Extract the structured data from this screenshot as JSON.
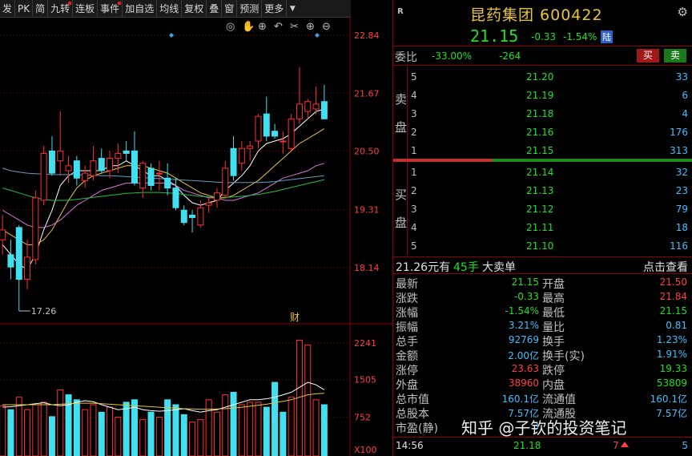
{
  "toolbar": {
    "items": [
      {
        "label": "发",
        "dot": false
      },
      {
        "label": "PK",
        "dot": false
      },
      {
        "label": "简",
        "dot": false
      },
      {
        "label": "九转",
        "dot": true
      },
      {
        "label": "连板",
        "dot": false
      },
      {
        "label": "事件",
        "dot": true
      },
      {
        "label": "加自选",
        "dot": false
      },
      {
        "label": "均线",
        "dot": false
      },
      {
        "label": "复权",
        "dot": false
      },
      {
        "label": "叠",
        "dot": false
      },
      {
        "label": "窗",
        "dot": false
      },
      {
        "label": "预测",
        "dot": false
      },
      {
        "label": "更多",
        "dot": false
      }
    ],
    "dropdown_icon": "dropdown-arrow-icon"
  },
  "chart_tools": [
    "eye-icon",
    "hand-icon",
    "zoom-in-icon",
    "undo-icon",
    "scissors-icon",
    "plus-circle-icon",
    "minus-circle-icon"
  ],
  "chart_data": [
    {
      "type": "candlestick",
      "y_ticks": [
        "22.84",
        "21.67",
        "20.50",
        "19.31",
        "18.14"
      ],
      "ylim": [
        17.0,
        23.2
      ],
      "low_marker": "17.26",
      "event_marker": "财",
      "candles": [
        {
          "o": 18.7,
          "h": 19.2,
          "l": 18.4,
          "c": 18.9
        },
        {
          "o": 18.4,
          "h": 18.7,
          "l": 17.9,
          "c": 18.15
        },
        {
          "o": 18.95,
          "h": 19.0,
          "l": 17.26,
          "c": 17.9
        },
        {
          "o": 17.9,
          "h": 18.7,
          "l": 17.7,
          "c": 18.35
        },
        {
          "o": 18.3,
          "h": 19.7,
          "l": 18.2,
          "c": 19.55
        },
        {
          "o": 19.5,
          "h": 20.6,
          "l": 19.4,
          "c": 20.45
        },
        {
          "o": 20.5,
          "h": 20.8,
          "l": 20.0,
          "c": 20.05
        },
        {
          "o": 20.3,
          "h": 21.3,
          "l": 20.0,
          "c": 20.5
        },
        {
          "o": 20.1,
          "h": 20.4,
          "l": 19.85,
          "c": 20.2
        },
        {
          "o": 20.3,
          "h": 20.4,
          "l": 19.8,
          "c": 19.95
        },
        {
          "o": 19.9,
          "h": 20.2,
          "l": 19.75,
          "c": 20.05
        },
        {
          "o": 20.0,
          "h": 20.6,
          "l": 19.9,
          "c": 20.3
        },
        {
          "o": 20.35,
          "h": 20.55,
          "l": 20.05,
          "c": 20.1
        },
        {
          "o": 20.1,
          "h": 20.5,
          "l": 19.95,
          "c": 20.35
        },
        {
          "o": 20.35,
          "h": 20.65,
          "l": 20.05,
          "c": 20.45
        },
        {
          "o": 20.5,
          "h": 20.7,
          "l": 20.3,
          "c": 20.45
        },
        {
          "o": 20.5,
          "h": 20.9,
          "l": 19.8,
          "c": 19.85
        },
        {
          "o": 19.75,
          "h": 20.3,
          "l": 19.55,
          "c": 20.25
        },
        {
          "o": 20.15,
          "h": 20.25,
          "l": 19.7,
          "c": 19.8
        },
        {
          "o": 20.05,
          "h": 20.3,
          "l": 19.7,
          "c": 20.05
        },
        {
          "o": 19.95,
          "h": 20.25,
          "l": 19.6,
          "c": 19.75
        },
        {
          "o": 19.75,
          "h": 19.95,
          "l": 19.3,
          "c": 19.35
        },
        {
          "o": 19.3,
          "h": 19.4,
          "l": 19.0,
          "c": 19.05
        },
        {
          "o": 19.2,
          "h": 19.3,
          "l": 18.85,
          "c": 19.15
        },
        {
          "o": 19.0,
          "h": 19.5,
          "l": 18.95,
          "c": 19.35
        },
        {
          "o": 19.4,
          "h": 19.55,
          "l": 19.25,
          "c": 19.45
        },
        {
          "o": 19.5,
          "h": 19.75,
          "l": 19.35,
          "c": 19.65
        },
        {
          "o": 19.6,
          "h": 20.3,
          "l": 19.55,
          "c": 20.15
        },
        {
          "o": 20.55,
          "h": 20.8,
          "l": 19.9,
          "c": 20.0
        },
        {
          "o": 20.25,
          "h": 20.7,
          "l": 20.1,
          "c": 20.55
        },
        {
          "o": 20.55,
          "h": 20.7,
          "l": 20.3,
          "c": 20.6
        },
        {
          "o": 20.7,
          "h": 21.25,
          "l": 20.55,
          "c": 21.2
        },
        {
          "o": 21.25,
          "h": 21.6,
          "l": 20.7,
          "c": 20.8
        },
        {
          "o": 20.9,
          "h": 21.05,
          "l": 20.75,
          "c": 20.8
        },
        {
          "o": 20.7,
          "h": 20.9,
          "l": 20.45,
          "c": 20.7
        },
        {
          "o": 20.55,
          "h": 21.25,
          "l": 20.5,
          "c": 21.15
        },
        {
          "o": 21.15,
          "h": 22.2,
          "l": 21.05,
          "c": 21.45
        },
        {
          "o": 21.3,
          "h": 21.55,
          "l": 21.15,
          "c": 21.5
        },
        {
          "o": 21.35,
          "h": 21.8,
          "l": 21.25,
          "c": 21.45
        },
        {
          "o": 21.5,
          "h": 21.84,
          "l": 21.15,
          "c": 21.15
        }
      ],
      "ma": [
        {
          "color": "#ffffff",
          "values": [
            18.6,
            18.4,
            18.2,
            18.1,
            18.4,
            18.9,
            19.3,
            19.8,
            20.0,
            20.1,
            20.1,
            20.1,
            20.1,
            20.2,
            20.2,
            20.3,
            20.2,
            20.1,
            20.0,
            20.0,
            19.9,
            19.8,
            19.6,
            19.45,
            19.4,
            19.45,
            19.5,
            19.7,
            19.85,
            20.0,
            20.2,
            20.5,
            20.65,
            20.7,
            20.75,
            20.85,
            21.0,
            21.15,
            21.3,
            21.35
          ]
        },
        {
          "color": "#e8c440",
          "values": [
            18.9,
            18.8,
            18.7,
            18.6,
            18.6,
            18.7,
            18.9,
            19.2,
            19.5,
            19.75,
            19.9,
            20.0,
            20.05,
            20.1,
            20.15,
            20.2,
            20.2,
            20.2,
            20.15,
            20.1,
            20.05,
            19.95,
            19.85,
            19.75,
            19.65,
            19.6,
            19.55,
            19.55,
            19.6,
            19.7,
            19.8,
            19.9,
            20.05,
            20.2,
            20.35,
            20.5,
            20.65,
            20.75,
            20.85,
            20.95
          ]
        },
        {
          "color": "#e070e0",
          "values": [
            19.3,
            19.2,
            19.1,
            19.0,
            18.95,
            18.95,
            19.0,
            19.1,
            19.25,
            19.4,
            19.5,
            19.6,
            19.7,
            19.75,
            19.8,
            19.85,
            19.85,
            19.85,
            19.85,
            19.85,
            19.85,
            19.8,
            19.7,
            19.65,
            19.6,
            19.55,
            19.55,
            19.5,
            19.5,
            19.55,
            19.6,
            19.65,
            19.75,
            19.85,
            19.95,
            20.0,
            20.05,
            20.1,
            20.2,
            20.25
          ]
        },
        {
          "color": "#20c040",
          "values": [
            19.75,
            19.7,
            19.65,
            19.6,
            19.55,
            19.52,
            19.5,
            19.5,
            19.5,
            19.52,
            19.54,
            19.56,
            19.58,
            19.6,
            19.62,
            19.64,
            19.65,
            19.66,
            19.66,
            19.66,
            19.65,
            19.64,
            19.62,
            19.6,
            19.58,
            19.57,
            19.56,
            19.56,
            19.57,
            19.58,
            19.6,
            19.62,
            19.65,
            19.68,
            19.72,
            19.76,
            19.8,
            19.84,
            19.88,
            19.92
          ]
        },
        {
          "color": "#60a0c0",
          "values": [
            20.15,
            20.1,
            20.07,
            20.05,
            20.04,
            20.03,
            20.02,
            20.02,
            20.02,
            20.02,
            20.01,
            20.01,
            20.0,
            20.0,
            19.99,
            19.98,
            19.97,
            19.96,
            19.95,
            19.94,
            19.93,
            19.92,
            19.91,
            19.9,
            19.89,
            19.88,
            19.87,
            19.86,
            19.86,
            19.86,
            19.86,
            19.86,
            19.87,
            19.88,
            19.9,
            19.92,
            19.94,
            19.96,
            19.98,
            20.0
          ]
        }
      ]
    },
    {
      "type": "bar",
      "y_ticks": [
        "2241",
        "1505",
        "752"
      ],
      "unit": "X100",
      "ylim": [
        0,
        2500
      ],
      "values": [
        980,
        900,
        1150,
        900,
        1000,
        1050,
        760,
        1300,
        1200,
        1100,
        900,
        1000,
        850,
        950,
        750,
        1050,
        1100,
        700,
        850,
        750,
        1100,
        1000,
        800,
        650,
        700,
        1100,
        850,
        1200,
        1250,
        1000,
        1050,
        1050,
        950,
        1450,
        850,
        1150,
        2300,
        2200,
        1100,
        1000
      ],
      "up": [
        true,
        false,
        true,
        true,
        true,
        true,
        false,
        true,
        false,
        false,
        true,
        true,
        false,
        true,
        true,
        false,
        false,
        true,
        false,
        true,
        false,
        false,
        false,
        true,
        true,
        true,
        true,
        true,
        false,
        true,
        true,
        true,
        false,
        false,
        false,
        true,
        true,
        true,
        true,
        false
      ],
      "ma": [
        {
          "color": "#ffffff",
          "values": [
            950,
            960,
            980,
            1000,
            1020,
            1040,
            1000,
            980,
            1000,
            1050,
            1080,
            1060,
            1000,
            950,
            900,
            920,
            950,
            900,
            880,
            870,
            880,
            900,
            920,
            880,
            850,
            880,
            900,
            950,
            1000,
            1050,
            1100,
            1100,
            1120,
            1150,
            1200,
            1250,
            1350,
            1450,
            1400,
            1300
          ]
        },
        {
          "color": "#e8c440",
          "values": [
            1000,
            1000,
            1000,
            1000,
            1000,
            1000,
            1000,
            1010,
            1020,
            1030,
            1030,
            1030,
            1020,
            1010,
            1000,
            990,
            980,
            970,
            960,
            950,
            940,
            930,
            920,
            915,
            910,
            910,
            915,
            920,
            930,
            950,
            970,
            990,
            1010,
            1040,
            1070,
            1100,
            1150,
            1200,
            1220,
            1230
          ]
        }
      ]
    }
  ],
  "quote": {
    "name": "昆药集团 600422",
    "price": "21.15",
    "change": "-0.33",
    "change_pct": "-1.54%",
    "board_badge": "陆",
    "r_mark": "R",
    "settings_icon": "gear-icon",
    "weibi_label": "委比",
    "weibi_pct": "-33.00%",
    "weicha": "-264",
    "buy_label": "买",
    "sell_label": "卖"
  },
  "ask_side": [
    "卖",
    "盘"
  ],
  "bid_side": [
    "买",
    "盘"
  ],
  "asks": [
    {
      "level": "5",
      "price": "21.20",
      "vol": "33"
    },
    {
      "level": "4",
      "price": "21.19",
      "vol": "6"
    },
    {
      "level": "3",
      "price": "21.18",
      "vol": "4"
    },
    {
      "level": "2",
      "price": "21.16",
      "vol": "176"
    },
    {
      "level": "1",
      "price": "21.15",
      "vol": "313"
    }
  ],
  "bids": [
    {
      "level": "1",
      "price": "21.14",
      "vol": "32"
    },
    {
      "level": "2",
      "price": "21.13",
      "vol": "23"
    },
    {
      "level": "3",
      "price": "21.12",
      "vol": "79"
    },
    {
      "level": "4",
      "price": "21.11",
      "vol": "18"
    },
    {
      "level": "5",
      "price": "21.10",
      "vol": "116"
    }
  ],
  "trade": {
    "price_text": "21.26元有",
    "vol_text": "45手",
    "type_text": "大卖单",
    "link_text": "点击查看"
  },
  "stats": [
    {
      "l1": "最新",
      "v1": "21.15",
      "c1": "green",
      "l2": "开盘",
      "v2": "21.50",
      "c2": "red"
    },
    {
      "l1": "涨跌",
      "v1": "-0.33",
      "c1": "green",
      "l2": "最高",
      "v2": "21.84",
      "c2": "red"
    },
    {
      "l1": "涨幅",
      "v1": "-1.54%",
      "c1": "green",
      "l2": "最低",
      "v2": "21.15",
      "c2": "green"
    },
    {
      "l1": "振幅",
      "v1": "3.21%",
      "c1": "cyan",
      "l2": "量比",
      "v2": "0.81",
      "c2": "cyan"
    },
    {
      "l1": "总手",
      "v1": "92769",
      "c1": "cyan",
      "l2": "换手",
      "v2": "1.23%",
      "c2": "cyan"
    },
    {
      "l1": "金额",
      "v1": "2.00亿",
      "c1": "cyan",
      "l2": "换手(实)",
      "v2": "1.91%",
      "c2": "cyan"
    },
    {
      "l1": "涨停",
      "v1": "23.63",
      "c1": "red",
      "l2": "跌停",
      "v2": "19.33",
      "c2": "green"
    },
    {
      "l1": "外盘",
      "v1": "38960",
      "c1": "red",
      "l2": "内盘",
      "v2": "53809",
      "c2": "green"
    },
    {
      "l1": "总市值",
      "v1": "160.1亿",
      "c1": "cyan",
      "l2": "流通值",
      "v2": "160.1亿",
      "c2": "cyan"
    },
    {
      "l1": "总股本",
      "v1": "7.57亿",
      "c1": "cyan",
      "l2": "流通股",
      "v2": "7.57亿",
      "c2": "cyan"
    },
    {
      "l1": "市盈(静)",
      "v1": "3",
      "c1": "cyan",
      "l2": "",
      "v2": "",
      "c2": "cyan"
    }
  ],
  "tick": {
    "time": "14:56",
    "price": "21.18",
    "vol": "7",
    "n": "5"
  },
  "watermark": "知乎 @子钦的投资笔记",
  "colors": {
    "up": "#ff3030",
    "down": "#40e0f0",
    "grid": "#8b0000",
    "ask_bar": "#c03030",
    "bid_bar": "#1e8a1e"
  }
}
